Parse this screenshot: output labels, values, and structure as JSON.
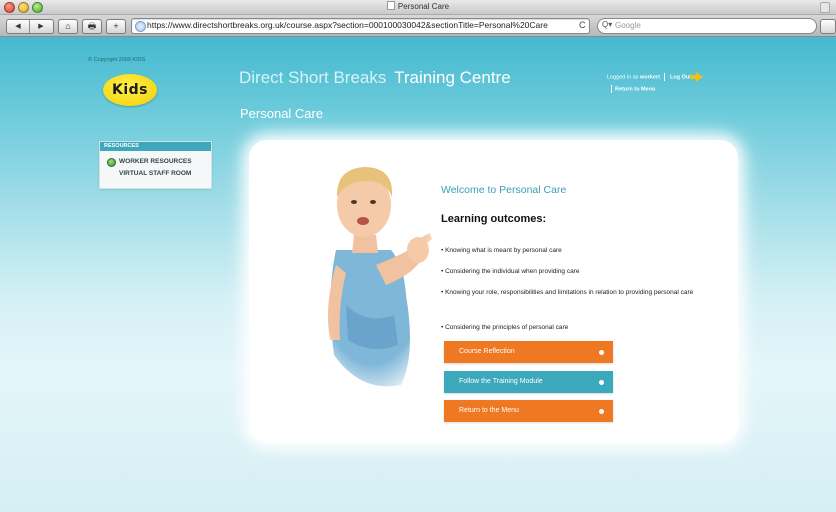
{
  "browser": {
    "window_title": "Personal Care",
    "url": "https://www.directshortbreaks.org.uk/course.aspx?section=000100030042&sectionTitle=Personal%20Care",
    "search_placeholder": "Google",
    "search_prefix": "Q▾",
    "back_glyph": "◀",
    "forward_glyph": "▶",
    "home_glyph": "⌂",
    "print_glyph": "🖶",
    "add_glyph": "+",
    "reload_glyph": "C"
  },
  "header": {
    "copyright": "© Copyright 2009 KIDS",
    "logo_text": "Kids",
    "brand_part1": "Direct Short Breaks",
    "brand_part2": "Training Centre",
    "page_title": "Personal Care",
    "logged_in_prefix": "Logged in as",
    "username": "workert",
    "logout_label": "Log Out",
    "return_label": "Return to Menu"
  },
  "sidebar": {
    "heading": "RESOURCES",
    "items": [
      {
        "label": "WORKER RESOURCES"
      },
      {
        "label": "VIRTUAL STAFF ROOM"
      }
    ]
  },
  "content": {
    "welcome": "Welcome to Personal Care",
    "heading": "Learning outcomes:",
    "outcomes": [
      "• Knowing what is meant by personal care",
      "• Considering the individual when providing care",
      "• Knowing your role, responsibilities and limitations in relation to providing personal care",
      "• Considering the principles of personal care"
    ],
    "buttons": [
      {
        "label": "Course Reflection",
        "color": "#ef7823"
      },
      {
        "label": "Follow the Training Module",
        "color": "#3ba8bc"
      },
      {
        "label": "Return to the Menu",
        "color": "#ef7823"
      }
    ]
  },
  "colors": {
    "page_top": "#45b9cf",
    "accent_teal": "#3ba8bc",
    "accent_orange": "#ef7823",
    "logo_yellow": "#f1cf06"
  }
}
